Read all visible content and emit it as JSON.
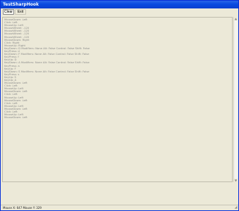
{
  "window": {
    "title": "TestSharpHook"
  },
  "toolbar": {
    "clear_label": "Clear",
    "exit_label": "Exit"
  },
  "log": {
    "lines": [
      "MouseDown: Left",
      "Click: Left",
      "MouseUp: Left",
      "MouseWheel: -120",
      "MouseWheel: -120",
      "MouseWheel: -120",
      "MouseWheel: -120",
      "MouseDown: Right",
      "Click: Right",
      "MouseUp: Right",
      "KeyDown: D Modifiers: None Alt: False Control: False Shift: False",
      "KeyPress: d",
      "KeyDown: F Modifiers: None Alt: False Control: False Shift: False",
      "KeyPress: f",
      "KeyUp: D",
      "KeyDown: A Modifiers: None Alt: False Control: False Shift: False",
      "KeyPress: a",
      "KeyUp: F",
      "KeyDown: S Modifiers: None Alt: False Control: False Shift: False",
      "KeyPress: s",
      "KeyUp: S",
      "KeyUp: A",
      "MouseDown: Left",
      "Click: Left",
      "MouseUp: Left",
      "MouseDown: Left",
      "Click: Left",
      "MouseUp: Left",
      "MouseDown: Left",
      "Click: Left",
      "MouseUp: Left",
      "MouseDown: Left",
      "Click: Left",
      "MouseUp: Left",
      "MouseDown: Left"
    ]
  },
  "status": {
    "text": "Mouse X: 647 Mouse Y: 329"
  },
  "colors": {
    "titlebar": "#0a4be0",
    "window_bg": "#ece9d8",
    "log_text": "#8c8c8c"
  },
  "icons": {
    "scroll_up": "scroll-up-arrow-icon",
    "scroll_down": "scroll-down-arrow-icon",
    "resize_grip": "resize-grip-icon"
  }
}
